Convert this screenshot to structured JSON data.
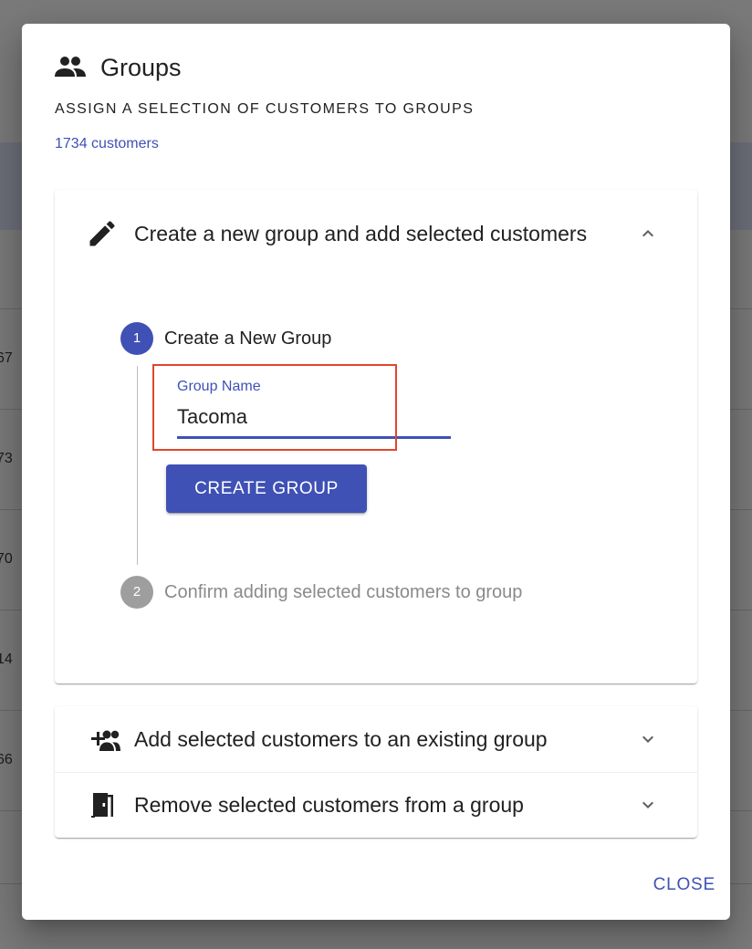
{
  "background": {
    "row_fragments": [
      "67",
      "73",
      "70",
      "14",
      "66"
    ]
  },
  "dialog": {
    "title_icon": "people-icon",
    "title": "Groups",
    "subtitle": "ASSIGN A SELECTION OF CUSTOMERS TO GROUPS",
    "customer_count": "1734 customers",
    "close_label": "CLOSE"
  },
  "panels": {
    "create": {
      "icon": "pencil-icon",
      "label": "Create a new group and add selected customers",
      "expanded": true,
      "chevron": "chevron-up-icon",
      "stepper": {
        "step1": {
          "number": "1",
          "label": "Create a New Group",
          "field_label": "Group Name",
          "field_value": "Tacoma",
          "button_label": "CREATE GROUP"
        },
        "step2": {
          "number": "2",
          "label": "Confirm adding selected customers to group"
        }
      }
    },
    "add_existing": {
      "icon": "group-add-icon",
      "label": "Add selected customers to an existing group",
      "expanded": false,
      "chevron": "chevron-down-icon"
    },
    "remove": {
      "icon": "exit-door-icon",
      "label": "Remove selected customers from a group",
      "expanded": false,
      "chevron": "chevron-down-icon"
    }
  },
  "colors": {
    "primary": "#3f51b5",
    "highlight": "#e2452d",
    "inactive_step": "#9e9e9e"
  }
}
